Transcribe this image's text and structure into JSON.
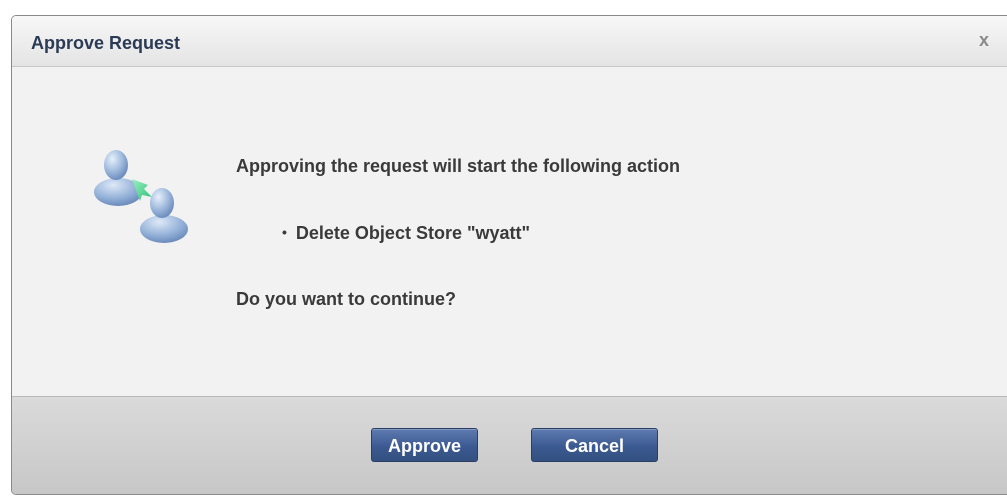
{
  "dialog": {
    "title": "Approve Request",
    "close_label": "x",
    "message": "Approving the request will start the following action",
    "actions": [
      "Delete Object Store \"wyatt\""
    ],
    "question": "Do you want to continue?",
    "approve_label": "Approve",
    "cancel_label": "Cancel",
    "icon": "users-transfer-icon"
  },
  "colors": {
    "title_text": "#2b3a55",
    "button_blue": "#3c5a92",
    "body_text": "#3a3a3a"
  }
}
